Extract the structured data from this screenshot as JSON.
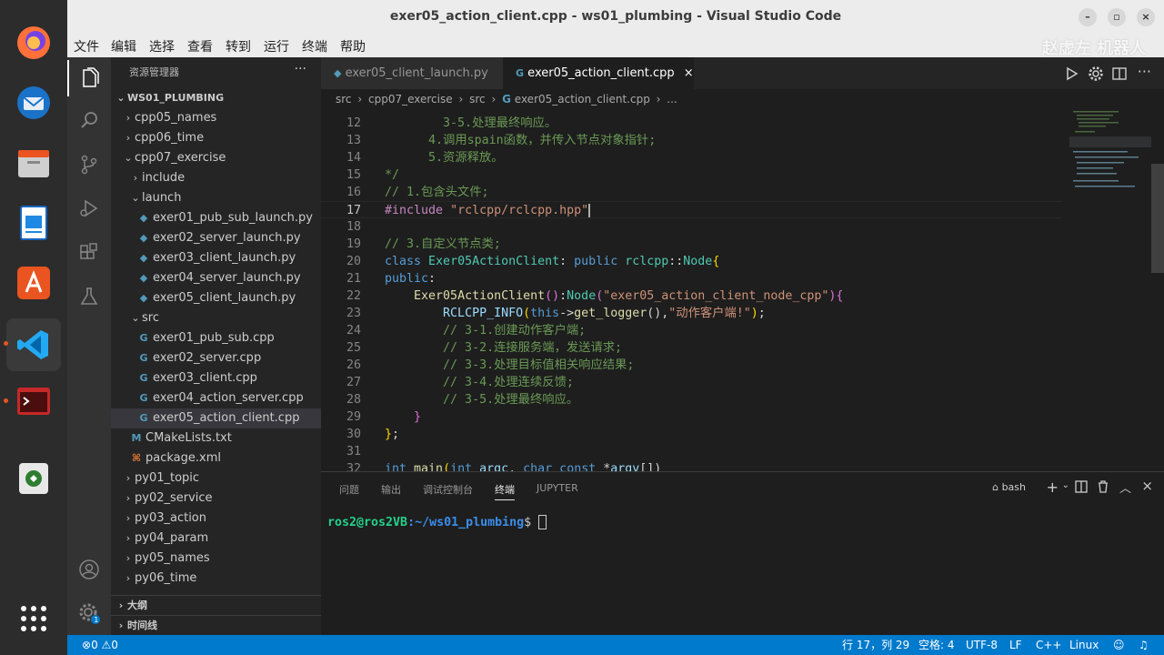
{
  "window": {
    "title": "exer05_action_client.cpp - ws01_plumbing - Visual Studio Code"
  },
  "menu": [
    "文件",
    "编辑",
    "选择",
    "查看",
    "转到",
    "运行",
    "终端",
    "帮助"
  ],
  "watermark": "赵虚左 机器人",
  "dock": [
    "firefox-icon",
    "thunderbird-icon",
    "files-icon",
    "writer-icon",
    "software-icon",
    "vscode-icon",
    "terminal-icon",
    "trash-icon",
    "apps-grid-icon"
  ],
  "sidebar": {
    "header": "资源管理器",
    "more": "···",
    "root": "WS01_PLUMBING",
    "items": [
      {
        "label": "cpp05_names",
        "kind": "folder",
        "open": false,
        "indent": 1
      },
      {
        "label": "cpp06_time",
        "kind": "folder",
        "open": false,
        "indent": 1
      },
      {
        "label": "cpp07_exercise",
        "kind": "folder",
        "open": true,
        "indent": 1
      },
      {
        "label": "include",
        "kind": "folder",
        "open": false,
        "indent": 2
      },
      {
        "label": "launch",
        "kind": "folder",
        "open": true,
        "indent": 2
      },
      {
        "label": "exer01_pub_sub_launch.py",
        "kind": "py",
        "indent": 3
      },
      {
        "label": "exer02_server_launch.py",
        "kind": "py",
        "indent": 3
      },
      {
        "label": "exer03_client_launch.py",
        "kind": "py",
        "indent": 3
      },
      {
        "label": "exer04_server_launch.py",
        "kind": "py",
        "indent": 3
      },
      {
        "label": "exer05_client_launch.py",
        "kind": "py",
        "indent": 3
      },
      {
        "label": "src",
        "kind": "folder",
        "open": true,
        "indent": 2
      },
      {
        "label": "exer01_pub_sub.cpp",
        "kind": "cpp",
        "indent": 3
      },
      {
        "label": "exer02_server.cpp",
        "kind": "cpp",
        "indent": 3
      },
      {
        "label": "exer03_client.cpp",
        "kind": "cpp",
        "indent": 3
      },
      {
        "label": "exer04_action_server.cpp",
        "kind": "cpp",
        "indent": 3
      },
      {
        "label": "exer05_action_client.cpp",
        "kind": "cpp",
        "indent": 3,
        "selected": true
      },
      {
        "label": "CMakeLists.txt",
        "kind": "cmake",
        "indent": 2
      },
      {
        "label": "package.xml",
        "kind": "xml",
        "indent": 2
      },
      {
        "label": "py01_topic",
        "kind": "folder",
        "open": false,
        "indent": 1
      },
      {
        "label": "py02_service",
        "kind": "folder",
        "open": false,
        "indent": 1
      },
      {
        "label": "py03_action",
        "kind": "folder",
        "open": false,
        "indent": 1
      },
      {
        "label": "py04_param",
        "kind": "folder",
        "open": false,
        "indent": 1
      },
      {
        "label": "py05_names",
        "kind": "folder",
        "open": false,
        "indent": 1
      },
      {
        "label": "py06_time",
        "kind": "folder",
        "open": false,
        "indent": 1
      }
    ],
    "outline": "大纲",
    "timeline": "时间线"
  },
  "tabs": [
    {
      "label": "exer05_client_launch.py",
      "active": false
    },
    {
      "label": "exer05_action_client.cpp",
      "active": true,
      "close": "×"
    }
  ],
  "breadcrumb": [
    "src",
    "cpp07_exercise",
    "src",
    "exer05_action_client.cpp",
    "..."
  ],
  "code_lines": [
    {
      "n": "12",
      "tokens": [
        [
          "c-com",
          "        3-5.处理最终响应。"
        ]
      ]
    },
    {
      "n": "13",
      "tokens": [
        [
          "c-com",
          "      4.调用spain函数，并传入节点对象指针;"
        ]
      ]
    },
    {
      "n": "14",
      "tokens": [
        [
          "c-com",
          "      5.资源释放。"
        ]
      ]
    },
    {
      "n": "15",
      "tokens": [
        [
          "c-com",
          "*/"
        ]
      ]
    },
    {
      "n": "16",
      "tokens": [
        [
          "c-com",
          "// 1.包含头文件;"
        ]
      ]
    },
    {
      "n": "17",
      "cur": true,
      "tokens": [
        [
          "c-pre",
          "#include "
        ],
        [
          "c-str",
          "\"rclcpp/rclcpp.hpp\""
        ]
      ]
    },
    {
      "n": "18",
      "tokens": []
    },
    {
      "n": "19",
      "tokens": [
        [
          "c-com",
          "// 3.自定义节点类;"
        ]
      ]
    },
    {
      "n": "20",
      "tokens": [
        [
          "c-kw",
          "class "
        ],
        [
          "c-typ",
          "Exer05ActionClient"
        ],
        [
          "c-txt",
          ": "
        ],
        [
          "c-kw",
          "public "
        ],
        [
          "c-typ",
          "rclcpp"
        ],
        [
          "c-txt",
          "::"
        ],
        [
          "c-typ",
          "Node"
        ],
        [
          "c-br",
          "{"
        ]
      ]
    },
    {
      "n": "21",
      "tokens": [
        [
          "c-kw",
          "public"
        ],
        [
          "c-txt",
          ":"
        ]
      ]
    },
    {
      "n": "22",
      "tokens": [
        [
          "c-txt",
          "    "
        ],
        [
          "c-fn",
          "Exer05ActionClient"
        ],
        [
          "c-br2",
          "()"
        ],
        [
          "c-txt",
          ":"
        ],
        [
          "c-typ",
          "Node"
        ],
        [
          "c-br2",
          "("
        ],
        [
          "c-str",
          "\"exer05_action_client_node_cpp\""
        ],
        [
          "c-br2",
          ")"
        ],
        [
          "c-br2",
          "{"
        ]
      ]
    },
    {
      "n": "23",
      "tokens": [
        [
          "c-txt",
          "        "
        ],
        [
          "c-var",
          "RCLCPP_INFO"
        ],
        [
          "c-br",
          "("
        ],
        [
          "c-kw",
          "this"
        ],
        [
          "c-txt",
          "->"
        ],
        [
          "c-fn",
          "get_logger"
        ],
        [
          "c-txt",
          "(),"
        ],
        [
          "c-str",
          "\"动作客户端!\""
        ],
        [
          "c-br",
          ")"
        ],
        [
          "c-txt",
          ";"
        ]
      ]
    },
    {
      "n": "24",
      "tokens": [
        [
          "c-com",
          "        // 3-1.创建动作客户端;"
        ]
      ]
    },
    {
      "n": "25",
      "tokens": [
        [
          "c-com",
          "        // 3-2.连接服务端，发送请求;"
        ]
      ]
    },
    {
      "n": "26",
      "tokens": [
        [
          "c-com",
          "        // 3-3.处理目标值相关响应结果;"
        ]
      ]
    },
    {
      "n": "27",
      "tokens": [
        [
          "c-com",
          "        // 3-4.处理连续反馈;"
        ]
      ]
    },
    {
      "n": "28",
      "tokens": [
        [
          "c-com",
          "        // 3-5.处理最终响应。"
        ]
      ]
    },
    {
      "n": "29",
      "tokens": [
        [
          "c-txt",
          "    "
        ],
        [
          "c-br2",
          "}"
        ]
      ]
    },
    {
      "n": "30",
      "tokens": [
        [
          "c-br",
          "}"
        ],
        [
          "c-txt",
          ";"
        ]
      ]
    },
    {
      "n": "31",
      "tokens": []
    },
    {
      "n": "32",
      "tokens": [
        [
          "c-kw",
          "int "
        ],
        [
          "c-fn",
          "main"
        ],
        [
          "c-br",
          "("
        ],
        [
          "c-kw",
          "int "
        ],
        [
          "c-var",
          "argc"
        ],
        [
          "c-txt",
          ", "
        ],
        [
          "c-kw",
          "char const "
        ],
        [
          "c-txt",
          "*"
        ],
        [
          "c-var",
          "argv"
        ],
        [
          "c-txt",
          "[])"
        ]
      ]
    }
  ],
  "panel": {
    "tabs": [
      "问题",
      "输出",
      "调试控制台",
      "终端",
      "JUPYTER"
    ],
    "active": "终端",
    "shell": "bash",
    "prompt_user": "ros2@ros2VB",
    "prompt_path": ":~/ws01_plumbing",
    "prompt_end": "$ "
  },
  "status": {
    "errors": "0",
    "warnings": "0",
    "position": "行 17，列 29",
    "spaces": "空格: 4",
    "encoding": "UTF-8",
    "eol": "LF",
    "language": "C++",
    "os": "Linux"
  },
  "colors": {
    "accent": "#007acc",
    "editor_bg": "#1e1e1e",
    "sidebar_bg": "#252526",
    "activity_bg": "#333333",
    "dock_bg": "#2c2c2c"
  }
}
